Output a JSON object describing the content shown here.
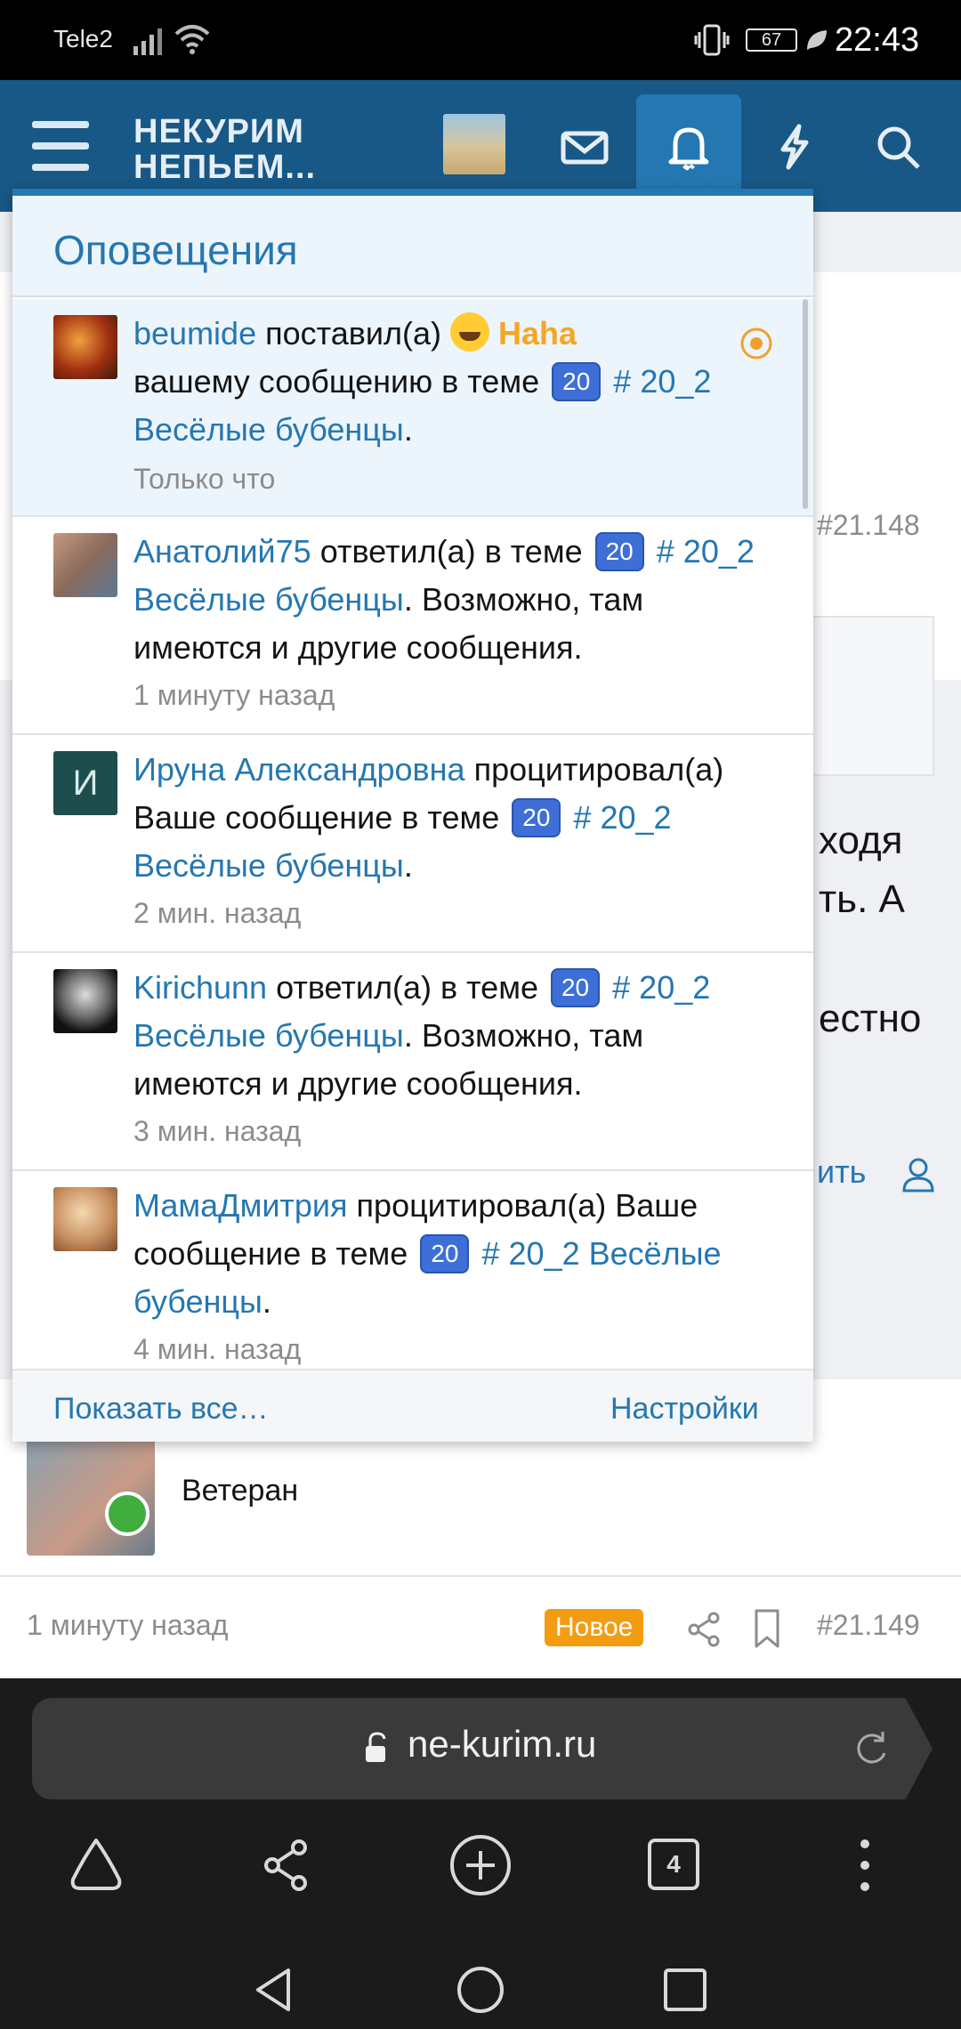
{
  "status_bar": {
    "carrier": "Tele2",
    "battery": "67",
    "time": "22:43"
  },
  "header": {
    "logo_line1": "НЕКУРИМ",
    "logo_line2": "НЕПЬЕМ...",
    "icons": [
      "menu-icon",
      "avatar-thumbnail",
      "mail-icon",
      "bell-icon",
      "lightning-icon",
      "search-icon"
    ]
  },
  "background": {
    "post_number_top": "#21.148",
    "fragment_1": "ходя",
    "fragment_2": "ть. А",
    "fragment_3": "естно",
    "fragment_link": "ить",
    "member_title": "Ветеран",
    "post_time": "1 минуту назад",
    "new_badge": "Новое",
    "post_number_bottom": "#21.149"
  },
  "notifications": {
    "title": "Оповещения",
    "items": [
      {
        "user": "beumide",
        "action": " поставил(а) ",
        "reaction": "Haha",
        "action2": "вашему сообщению в теме",
        "badge": "20",
        "thread": "# 20_2 Весёлые бубенцы",
        "tail": ".",
        "time": "Только что",
        "unread": true
      },
      {
        "user": "Анатолий75",
        "action": " ответил(а) в теме ",
        "badge": "20",
        "thread": "# 20_2 Весёлые бубенцы",
        "tail": ". Возможно, там имеются и другие сообщения.",
        "time": "1 минуту назад",
        "unread": false
      },
      {
        "user": "Ируна Александровна",
        "avatar_letter": "И",
        "action": " процитировал(а) Ваше сообщение в теме ",
        "badge": "20",
        "thread": "# 20_2 Весёлые бубенцы",
        "tail": ".",
        "time": "2 мин. назад",
        "unread": false
      },
      {
        "user": "Kirichunn",
        "action": " ответил(а) в теме ",
        "badge": "20",
        "thread": "# 20_2 Весёлые бубенцы",
        "tail": ". Возможно, там имеются и другие сообщения.",
        "time": "3 мин. назад",
        "unread": false
      },
      {
        "user": "МамаДмитрия",
        "action": " процитировал(а) Ваше сообщение в теме ",
        "badge": "20",
        "thread": "# 20_2 Весёлые бубенцы",
        "tail": ".",
        "time": "4 мин. назад",
        "unread": false
      }
    ],
    "show_all": "Показать все…",
    "settings": "Настройки"
  },
  "browser": {
    "url": "ne-kurim.ru",
    "tab_count": "4"
  },
  "colors": {
    "header": "#185886",
    "accent": "#2577b1",
    "badge": "#3d6fd6",
    "haha": "#f5a623",
    "new_badge": "#f39c12"
  }
}
